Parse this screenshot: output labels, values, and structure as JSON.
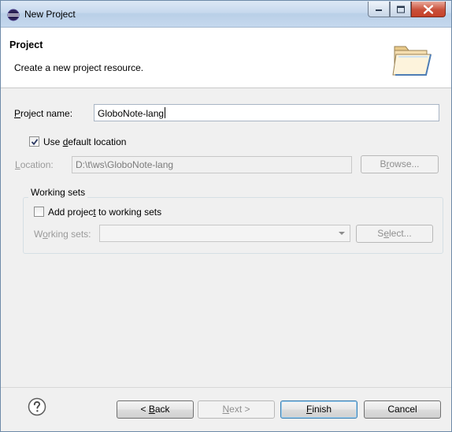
{
  "window": {
    "title": "New Project",
    "icon": "eclipse-icon",
    "controls": [
      "minimize-icon",
      "maximize-icon",
      "close-icon"
    ]
  },
  "banner": {
    "title": "Project",
    "description": "Create a new project resource.",
    "icon": "folder-icon"
  },
  "form": {
    "project_name": {
      "label_prefix": "",
      "label_mnemonic": "P",
      "label_rest": "roject name:",
      "value": "GloboNote-lang"
    },
    "default_location": {
      "checked": true,
      "label_prefix": "Use ",
      "label_mnemonic": "d",
      "label_rest": "efault location"
    },
    "location": {
      "label_mnemonic": "L",
      "label_rest": "ocation:",
      "value": "D:\\t\\ws\\GloboNote-lang",
      "browse_prefix": "B",
      "browse_mnemonic": "r",
      "browse_rest": "owse..."
    },
    "working_sets": {
      "group_title": "Working sets",
      "add_checked": false,
      "add_prefix": "Add projec",
      "add_mnemonic": "t",
      "add_rest": " to working sets",
      "sets_prefix": "W",
      "sets_mnemonic": "o",
      "sets_rest": "rking sets:",
      "sets_value": "",
      "select_prefix": "S",
      "select_mnemonic": "e",
      "select_rest": "lect..."
    }
  },
  "footer": {
    "help_icon": "help-icon",
    "back_prefix": "< ",
    "back_mnemonic": "B",
    "back_rest": "ack",
    "next_mnemonic": "N",
    "next_rest": "ext >",
    "finish_mnemonic": "F",
    "finish_rest": "inish",
    "cancel": "Cancel"
  }
}
